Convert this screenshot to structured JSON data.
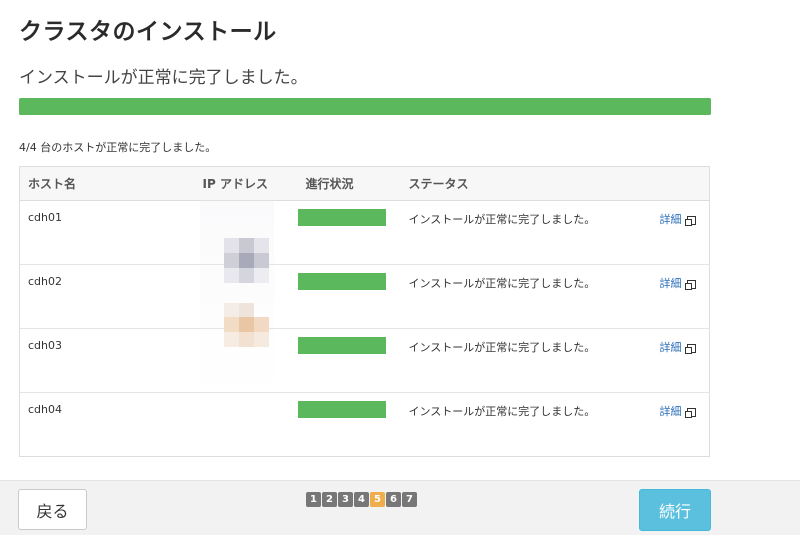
{
  "header": {
    "title": "クラスタのインストール",
    "subtitle": "インストールが正常に完了しました。"
  },
  "overall_progress": {
    "percent": 100,
    "color": "#5cb85c"
  },
  "summary": "4/4 台のホストが正常に完了しました。",
  "table": {
    "columns": [
      "ホスト名",
      "IP アドレス",
      "進行状況",
      "ステータス"
    ],
    "rows": [
      {
        "host": "cdh01",
        "ip": "",
        "progress": 100,
        "status": "インストールが正常に完了しました。",
        "detail": "詳細"
      },
      {
        "host": "cdh02",
        "ip": "",
        "progress": 100,
        "status": "インストールが正常に完了しました。",
        "detail": "詳細"
      },
      {
        "host": "cdh03",
        "ip": "",
        "progress": 100,
        "status": "インストールが正常に完了しました。",
        "detail": "詳細"
      },
      {
        "host": "cdh04",
        "ip": "",
        "progress": 100,
        "status": "インストールが正常に完了しました。",
        "detail": "詳細"
      }
    ]
  },
  "footer": {
    "back_label": "戻る",
    "next_label": "続行",
    "steps": [
      "1",
      "2",
      "3",
      "4",
      "5",
      "6",
      "7"
    ],
    "active_step": "5"
  },
  "colors": {
    "accent": "#5bc0de",
    "success": "#5cb85c",
    "step_active": "#f0ad4e",
    "step_inactive": "#777777",
    "link": "#2a6ebb"
  },
  "icons": {
    "detail_link": "external-link-icon"
  }
}
